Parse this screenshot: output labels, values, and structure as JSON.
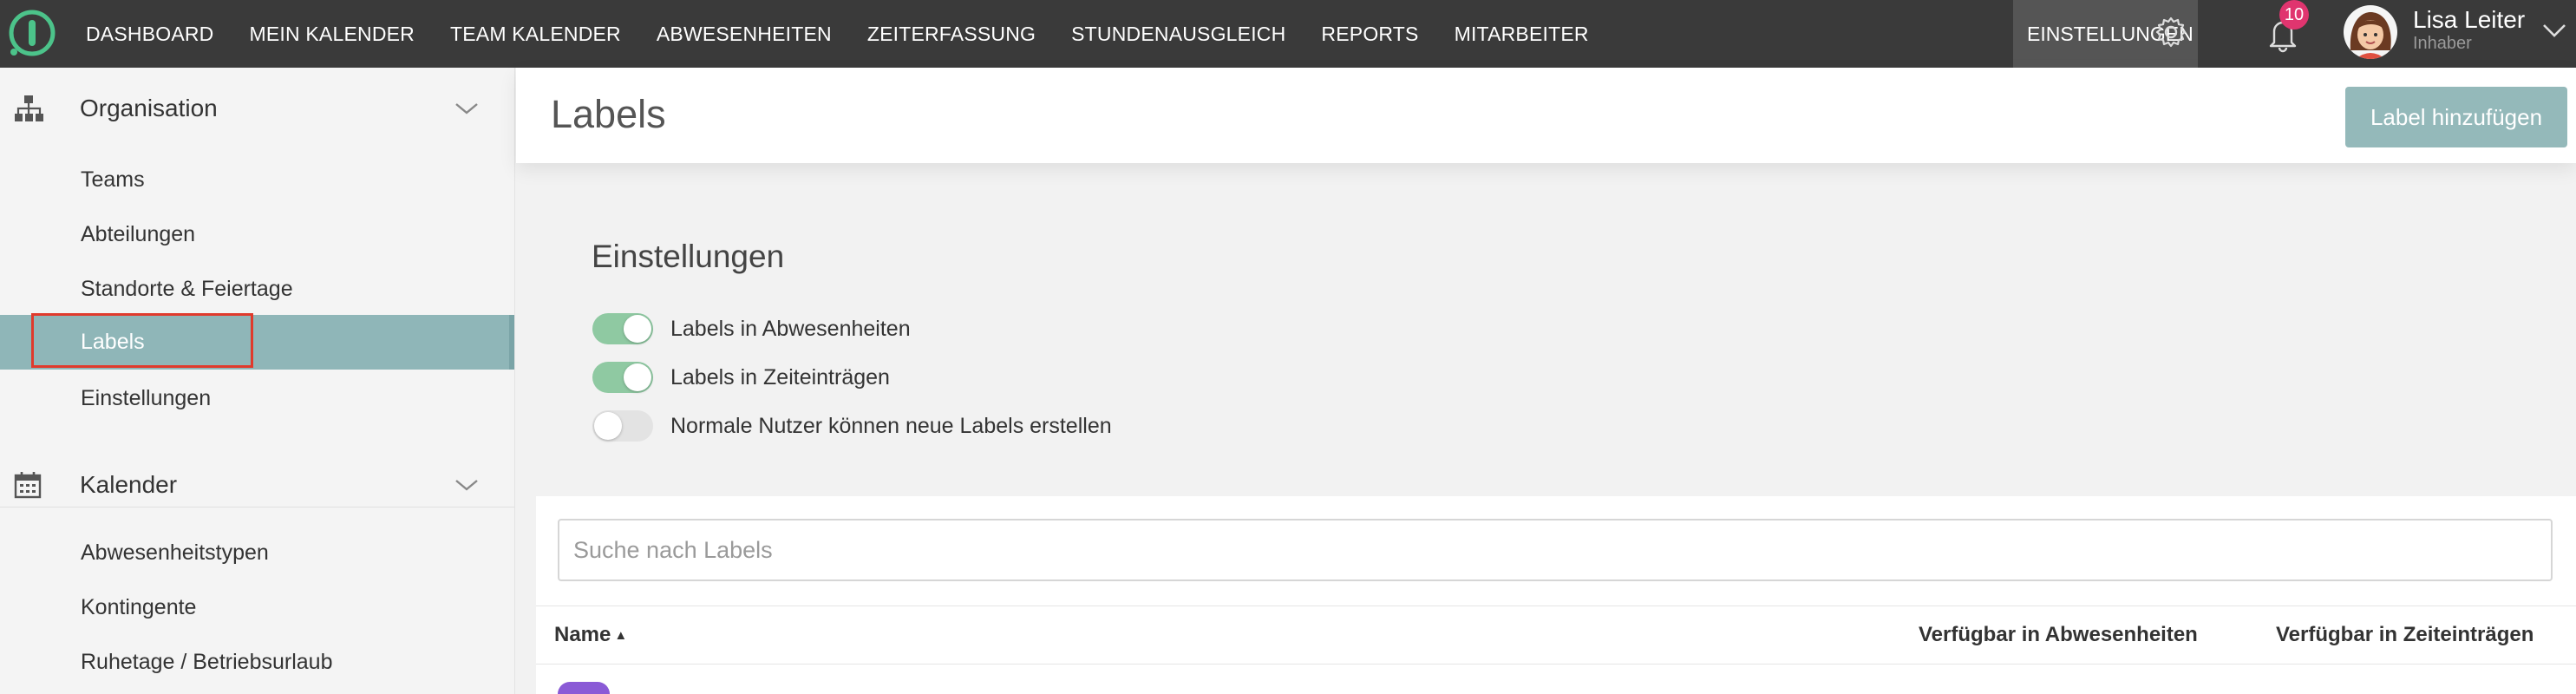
{
  "nav": {
    "items": [
      "DASHBOARD",
      "MEIN KALENDER",
      "TEAM KALENDER",
      "ABWESENHEITEN",
      "ZEITERFASSUNG",
      "STUNDENAUSGLEICH",
      "REPORTS",
      "MITARBEITER"
    ],
    "settings_label": "EINSTELLUNGEN",
    "notification_count": "10"
  },
  "user": {
    "name": "Lisa Leiter",
    "role": "Inhaber"
  },
  "sidebar": {
    "groups": [
      {
        "title": "Organisation",
        "icon": "org-chart-icon",
        "items": [
          "Teams",
          "Abteilungen",
          "Standorte & Feiertage",
          "Labels",
          "Einstellungen"
        ]
      },
      {
        "title": "Kalender",
        "icon": "calendar-icon",
        "items": [
          "Abwesenheitstypen",
          "Kontingente",
          "Ruhetage / Betriebsurlaub"
        ]
      }
    ],
    "active_item": "Labels"
  },
  "page": {
    "title": "Labels",
    "add_button": "Label hinzufügen"
  },
  "settings": {
    "title": "Einstellungen",
    "toggles": [
      {
        "label": "Labels in Abwesenheiten",
        "on": true
      },
      {
        "label": "Labels in Zeiteinträgen",
        "on": true
      },
      {
        "label": "Normale Nutzer können neue Labels erstellen",
        "on": false
      }
    ]
  },
  "table": {
    "search_placeholder": "Suche nach Labels",
    "columns": [
      "Name",
      "Verfügbar in Abwesenheiten",
      "Verfügbar in Zeiteinträgen"
    ],
    "sort_indicator": "▲"
  },
  "colors": {
    "topbar": "#3a3a3a",
    "accent": "#8fb6b8",
    "toggle_on": "#8fc9a2",
    "badge": "#e0356f",
    "highlight": "#e03a2c"
  }
}
